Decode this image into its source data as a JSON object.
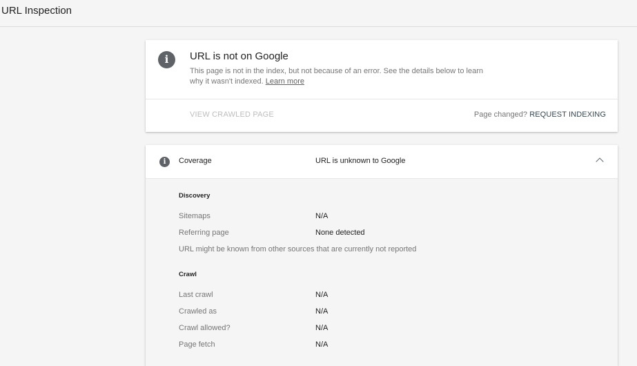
{
  "header": {
    "title": "URL Inspection"
  },
  "status": {
    "icon": "info-icon",
    "headline": "URL is not on Google",
    "description": "This page is not in the index, but not because of an error. See the details below to learn why it wasn't indexed.",
    "learn_more": "Learn more",
    "view_crawled_label": "VIEW CRAWLED PAGE",
    "page_changed_label": "Page changed?",
    "request_indexing_label": "REQUEST INDEXING"
  },
  "coverage": {
    "icon": "info-icon",
    "label": "Coverage",
    "value": "URL is unknown to Google",
    "expanded": true,
    "discovery": {
      "title": "Discovery",
      "rows": [
        {
          "label": "Sitemaps",
          "value": "N/A"
        },
        {
          "label": "Referring page",
          "value": "None detected"
        }
      ],
      "note": "URL might be known from other sources that are currently not reported"
    },
    "crawl": {
      "title": "Crawl",
      "rows": [
        {
          "label": "Last crawl",
          "value": "N/A"
        },
        {
          "label": "Crawled as",
          "value": "N/A"
        },
        {
          "label": "Crawl allowed?",
          "value": "N/A"
        },
        {
          "label": "Page fetch",
          "value": "N/A"
        }
      ]
    }
  },
  "colors": {
    "background": "#f5f5f5",
    "card": "#ffffff",
    "icon": "#5f6368",
    "disabled_text": "#bdbdbd",
    "secondary_text": "#757575"
  }
}
